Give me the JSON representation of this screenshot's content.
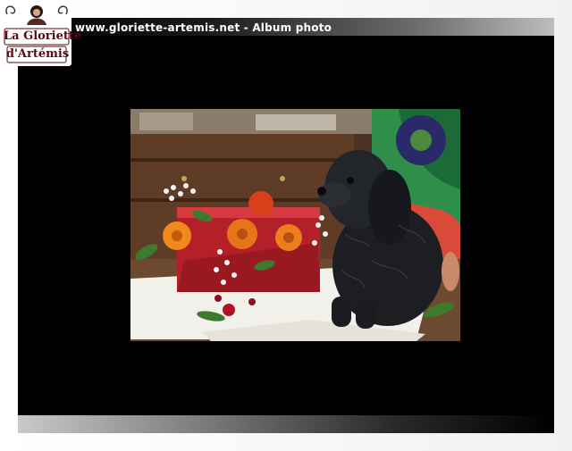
{
  "window": {
    "title": "www.gloriette-artemis.net - Album photo"
  },
  "logo": {
    "line1": "La Gloriette",
    "line2": "d'Artémis"
  },
  "photo": {
    "subject": "black-puppy-with-flowers"
  },
  "colors": {
    "viewer_bg": "#000000",
    "title_text": "#ffffff",
    "logo_text": "#5a0a12"
  }
}
